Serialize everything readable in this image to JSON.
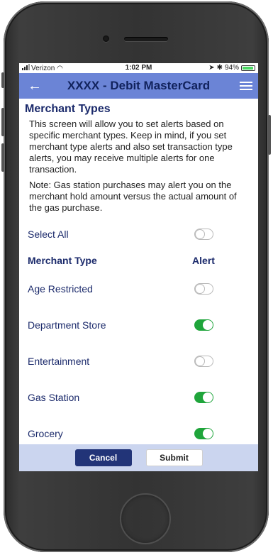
{
  "status_bar": {
    "carrier": "Verizon",
    "time": "1:02 PM",
    "battery": "94%",
    "battery_level": 0.94
  },
  "header": {
    "title": "XXXX - Debit MasterCard",
    "back_icon": "back-arrow-icon",
    "menu_icon": "hamburger-menu-icon"
  },
  "page": {
    "title": "Merchant Types",
    "intro": "This screen will allow you to set alerts based on specific merchant types. Keep in mind, if you set merchant type alerts and also set transaction type alerts, you may receive multiple alerts for one transaction.",
    "note": "Note: Gas station purchases may alert you on the merchant hold amount versus the actual amount of the gas purchase."
  },
  "select_all": {
    "label": "Select All",
    "on": false
  },
  "columns": {
    "type": "Merchant Type",
    "alert": "Alert"
  },
  "merchants": [
    {
      "label": "Age Restricted",
      "on": false
    },
    {
      "label": "Department Store",
      "on": true
    },
    {
      "label": "Entertainment",
      "on": false
    },
    {
      "label": "Gas Station",
      "on": true
    },
    {
      "label": "Grocery",
      "on": true
    }
  ],
  "footer": {
    "cancel_label": "Cancel",
    "submit_label": "Submit"
  },
  "colors": {
    "header_bg": "#6b84d6",
    "title_text": "#1b2a6b",
    "toggle_on": "#1fa53b",
    "footer_bg": "#cbd5ef",
    "cancel_bg": "#223478"
  }
}
